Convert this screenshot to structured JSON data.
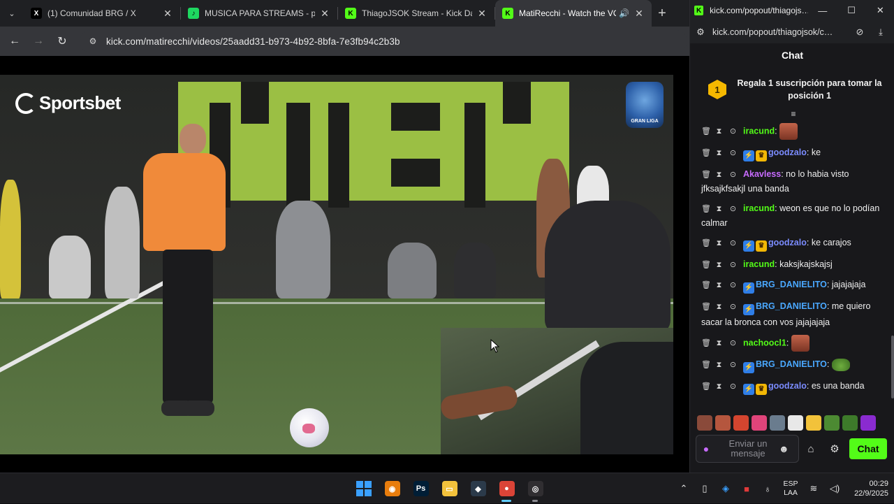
{
  "browser": {
    "tabs": [
      {
        "label": "(1) Comunidad BRG / X",
        "icon": "x-logo-icon",
        "icon_glyph": "X",
        "icon_bg": "#000000",
        "icon_fg": "#ffffff"
      },
      {
        "label": "MUSICA PARA STREAMS - play",
        "icon": "spotify-icon",
        "icon_glyph": "♪",
        "icon_bg": "#1ed760",
        "icon_fg": "#000000"
      },
      {
        "label": "ThiagoJSOK Stream - Kick Dash",
        "icon": "kick-icon",
        "icon_glyph": "K",
        "icon_bg": "#53fc18",
        "icon_fg": "#000000"
      },
      {
        "label": "MatiRecchi - Watch the VOD",
        "icon": "kick-icon",
        "icon_glyph": "K",
        "icon_bg": "#53fc18",
        "icon_fg": "#000000"
      }
    ],
    "url": "kick.com/matirecchi/videos/25aadd31-b973-4b92-8bfa-7e3fb94c2b3b"
  },
  "video": {
    "sponsor": "Sportsbet",
    "league_badge": "GRAN LIGA"
  },
  "chat_window": {
    "title": "kick.com/popout/thiagojs…",
    "url": "kick.com/popout/thiagojsok/c…",
    "header": "Chat",
    "pinned_badge": "1",
    "pinned_text": "Regala 1 suscripción para tomar la posición 1",
    "messages": [
      {
        "user": "iracund",
        "color": "#53fc18",
        "badges": [],
        "text": "",
        "emote": "face"
      },
      {
        "user": "goodzalo",
        "color": "#7b8cff",
        "badges": [
          "sub",
          "vip"
        ],
        "text": "ke",
        "emote": ""
      },
      {
        "user": "Akavless",
        "color": "#c86bff",
        "badges": [],
        "text": "no lo habia visto jfksajkfsakjl una banda",
        "emote": ""
      },
      {
        "user": "iracund",
        "color": "#53fc18",
        "badges": [],
        "text": "weon es que no lo podían calmar",
        "emote": ""
      },
      {
        "user": "goodzalo",
        "color": "#7b8cff",
        "badges": [
          "sub",
          "vip"
        ],
        "text": "ke carajos",
        "emote": ""
      },
      {
        "user": "iracund",
        "color": "#53fc18",
        "badges": [],
        "text": "kaksjkajskajsj",
        "emote": ""
      },
      {
        "user": "BRG_DANIELITO",
        "color": "#4aa8ff",
        "badges": [
          "sub"
        ],
        "text": "jajajajaja",
        "emote": ""
      },
      {
        "user": "BRG_DANIELITO",
        "color": "#4aa8ff",
        "badges": [
          "sub"
        ],
        "text": "me quiero sacar la bronca con vos jajajajaja",
        "emote": ""
      },
      {
        "user": "nachoocl1",
        "color": "#53fc18",
        "badges": [],
        "text": "",
        "emote": "face"
      },
      {
        "user": "BRG_DANIELITO",
        "color": "#4aa8ff",
        "badges": [
          "sub"
        ],
        "text": "",
        "emote": "frog"
      },
      {
        "user": "goodzalo",
        "color": "#7b8cff",
        "badges": [
          "sub",
          "vip"
        ],
        "text": "es una banda",
        "emote": ""
      }
    ],
    "emote_bar_colors": [
      "#8a4a3a",
      "#b5563e",
      "#d4452f",
      "#e0447a",
      "#6a7c8e",
      "#e8e8e8",
      "#f2c23a",
      "#4c8a32",
      "#3d7a2a",
      "#8a2bd0"
    ],
    "input_placeholder": "Enviar un mensaje",
    "send_label": "Chat"
  },
  "taskbar": {
    "apps": [
      {
        "name": "start-button",
        "glyph": "",
        "bg": "transparent",
        "running": false,
        "active": false
      },
      {
        "name": "blender-app",
        "glyph": "◉",
        "bg": "#e87d0d",
        "running": false,
        "active": false
      },
      {
        "name": "photoshop-app",
        "glyph": "Ps",
        "bg": "#001e36",
        "running": false,
        "active": false
      },
      {
        "name": "file-explorer-app",
        "glyph": "▭",
        "bg": "#f3c23c",
        "running": false,
        "active": false
      },
      {
        "name": "davinci-app",
        "glyph": "◆",
        "bg": "#2b3a4a",
        "running": false,
        "active": false
      },
      {
        "name": "chrome-app",
        "glyph": "●",
        "bg": "#db4437",
        "running": true,
        "active": true
      },
      {
        "name": "obs-app",
        "glyph": "◎",
        "bg": "#302e31",
        "running": true,
        "active": false
      }
    ],
    "language": "ESP",
    "layout": "LAA",
    "time": "00:29",
    "date": "22/9/2025"
  }
}
